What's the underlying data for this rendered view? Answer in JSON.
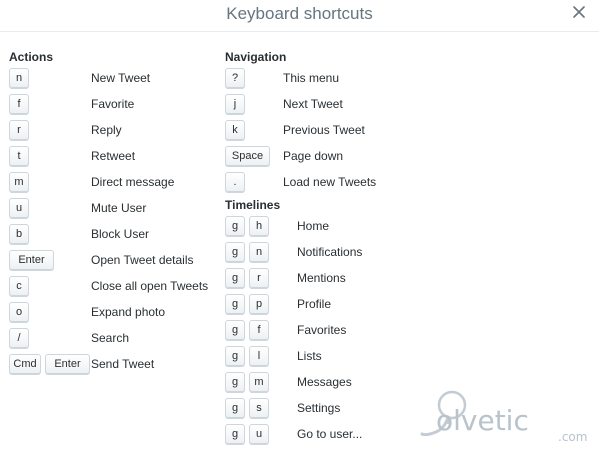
{
  "dialog": {
    "title": "Keyboard shortcuts",
    "close_icon": "close-icon"
  },
  "actions": {
    "heading": "Actions",
    "items": [
      {
        "keys": [
          "n"
        ],
        "label": "New Tweet"
      },
      {
        "keys": [
          "f"
        ],
        "label": "Favorite"
      },
      {
        "keys": [
          "r"
        ],
        "label": "Reply"
      },
      {
        "keys": [
          "t"
        ],
        "label": "Retweet"
      },
      {
        "keys": [
          "m"
        ],
        "label": "Direct message"
      },
      {
        "keys": [
          "u"
        ],
        "label": "Mute User"
      },
      {
        "keys": [
          "b"
        ],
        "label": "Block User"
      },
      {
        "keys": [
          "Enter"
        ],
        "label": "Open Tweet details"
      },
      {
        "keys": [
          "c"
        ],
        "label": "Close all open Tweets"
      },
      {
        "keys": [
          "o"
        ],
        "label": "Expand photo"
      },
      {
        "keys": [
          "/"
        ],
        "label": "Search"
      },
      {
        "keys": [
          "Cmd",
          "Enter"
        ],
        "label": "Send Tweet"
      }
    ]
  },
  "navigation": {
    "heading": "Navigation",
    "items": [
      {
        "keys": [
          "?"
        ],
        "label": "This menu"
      },
      {
        "keys": [
          "j"
        ],
        "label": "Next Tweet"
      },
      {
        "keys": [
          "k"
        ],
        "label": "Previous Tweet"
      },
      {
        "keys": [
          "Space"
        ],
        "label": "Page down"
      },
      {
        "keys": [
          "."
        ],
        "label": "Load new Tweets"
      }
    ]
  },
  "timelines": {
    "heading": "Timelines",
    "items": [
      {
        "keys": [
          "g",
          "h"
        ],
        "label": "Home"
      },
      {
        "keys": [
          "g",
          "n"
        ],
        "label": "Notifications"
      },
      {
        "keys": [
          "g",
          "r"
        ],
        "label": "Mentions"
      },
      {
        "keys": [
          "g",
          "p"
        ],
        "label": "Profile"
      },
      {
        "keys": [
          "g",
          "f"
        ],
        "label": "Favorites"
      },
      {
        "keys": [
          "g",
          "l"
        ],
        "label": "Lists"
      },
      {
        "keys": [
          "g",
          "m"
        ],
        "label": "Messages"
      },
      {
        "keys": [
          "g",
          "s"
        ],
        "label": "Settings"
      },
      {
        "keys": [
          "g",
          "u"
        ],
        "label": "Go to user..."
      }
    ]
  },
  "watermark": {
    "text": "olvetic",
    "suffix": ".com"
  }
}
